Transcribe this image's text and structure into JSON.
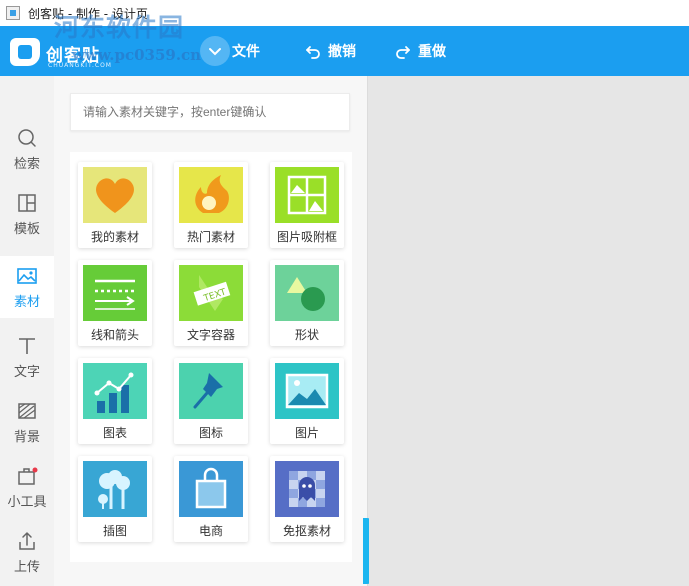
{
  "window": {
    "title": "创客贴 - 制作 - 设计页"
  },
  "brand": {
    "logo_text": "创客贴",
    "logo_sub": "CHUANGKIT.COM"
  },
  "watermark": {
    "text": "河东软件园",
    "url": "www.pc0359.cn"
  },
  "toolbar": {
    "file_label": "文件",
    "undo_label": "撤销",
    "redo_label": "重做"
  },
  "nav": {
    "items": [
      {
        "label": "检索",
        "icon": "search-icon"
      },
      {
        "label": "模板",
        "icon": "template-icon"
      },
      {
        "label": "素材",
        "icon": "image-icon",
        "active": true
      },
      {
        "label": "文字",
        "icon": "text-icon"
      },
      {
        "label": "背景",
        "icon": "background-icon"
      },
      {
        "label": "小工具",
        "icon": "toolbox-icon"
      },
      {
        "label": "上传",
        "icon": "upload-icon"
      }
    ]
  },
  "search": {
    "placeholder": "请输入素材关键字，按enter键确认"
  },
  "materials": {
    "tiles": [
      {
        "label": "我的素材",
        "icon": "heart-icon",
        "color": "#e8e87a"
      },
      {
        "label": "热门素材",
        "icon": "fire-icon",
        "color": "#e8e84a"
      },
      {
        "label": "图片吸附框",
        "icon": "image-frame-icon",
        "color": "#9fe02a"
      },
      {
        "label": "线和箭头",
        "icon": "lines-arrows-icon",
        "color": "#6ccf3a"
      },
      {
        "label": "文字容器",
        "icon": "text-container-icon",
        "color": "#8fdc3a"
      },
      {
        "label": "形状",
        "icon": "shapes-icon",
        "color": "#6ed39a"
      },
      {
        "label": "图表",
        "icon": "chart-icon",
        "color": "#4fd6b8"
      },
      {
        "label": "图标",
        "icon": "pin-icon",
        "color": "#4ed4b0"
      },
      {
        "label": "图片",
        "icon": "picture-icon",
        "color": "#2ec6c8"
      },
      {
        "label": "插图",
        "icon": "illustration-icon",
        "color": "#3aa8d6"
      },
      {
        "label": "电商",
        "icon": "shopping-bag-icon",
        "color": "#3a9ad8"
      },
      {
        "label": "免抠素材",
        "icon": "cutout-icon",
        "color": "#5870c8"
      }
    ]
  },
  "colors": {
    "accent": "#1b9ef0",
    "active_nav": "#1b9ef0"
  }
}
